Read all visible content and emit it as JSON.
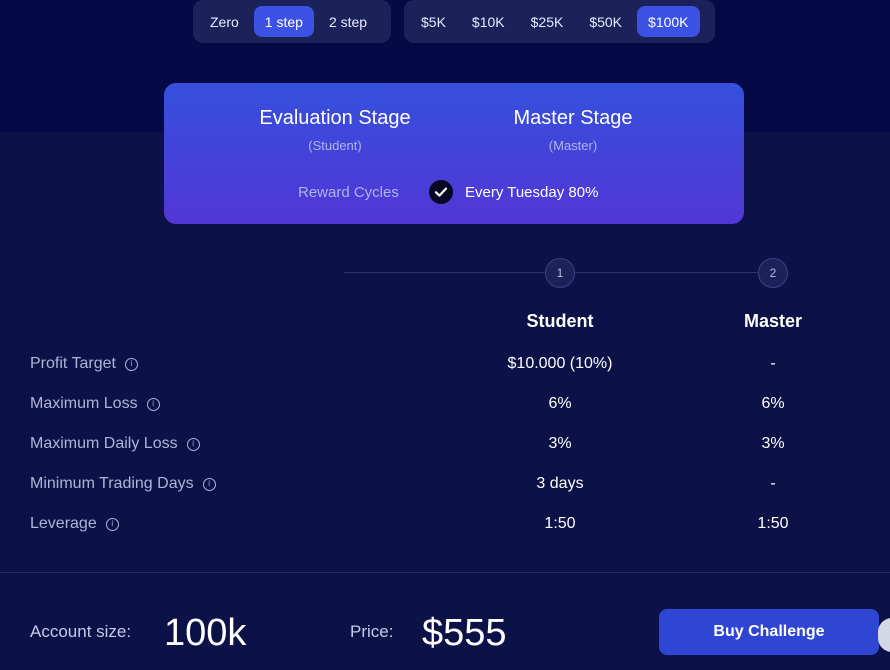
{
  "steps_toggle": {
    "options": [
      "Zero",
      "1 step",
      "2 step"
    ],
    "selected": "1 step"
  },
  "size_toggle": {
    "options": [
      "$5K",
      "$10K",
      "$25K",
      "$50K",
      "$100K"
    ],
    "selected": "$100K"
  },
  "stage_card": {
    "evaluation_title": "Evaluation Stage",
    "evaluation_sub": "(Student)",
    "master_title": "Master Stage",
    "master_sub": "(Master)",
    "reward_label": "Reward Cycles",
    "reward_value": "Every Tuesday 80%"
  },
  "progress_steps": [
    "1",
    "2"
  ],
  "columns": [
    "Student",
    "Master"
  ],
  "rows": [
    {
      "label": "Profit Target",
      "student": "$10.000 (10%)",
      "master": "-"
    },
    {
      "label": "Maximum Loss",
      "student": "6%",
      "master": "6%"
    },
    {
      "label": "Maximum Daily Loss",
      "student": "3%",
      "master": "3%"
    },
    {
      "label": "Minimum Trading Days",
      "student": "3 days",
      "master": "-"
    },
    {
      "label": "Leverage",
      "student": "1:50",
      "master": "1:50"
    }
  ],
  "info_glyph": "i",
  "footer": {
    "account_size_label": "Account size:",
    "account_size_value": "100k",
    "price_label": "Price:",
    "price_value": "$555",
    "buy_label": "Buy Challenge"
  },
  "colors": {
    "accent": "#3b52e4",
    "card_gradient_top": "#3550dc",
    "card_gradient_bottom": "#5236d6",
    "background": "#0c1148",
    "header_background": "#050a47"
  },
  "icons": {
    "check": "check-icon",
    "info": "info-icon"
  }
}
